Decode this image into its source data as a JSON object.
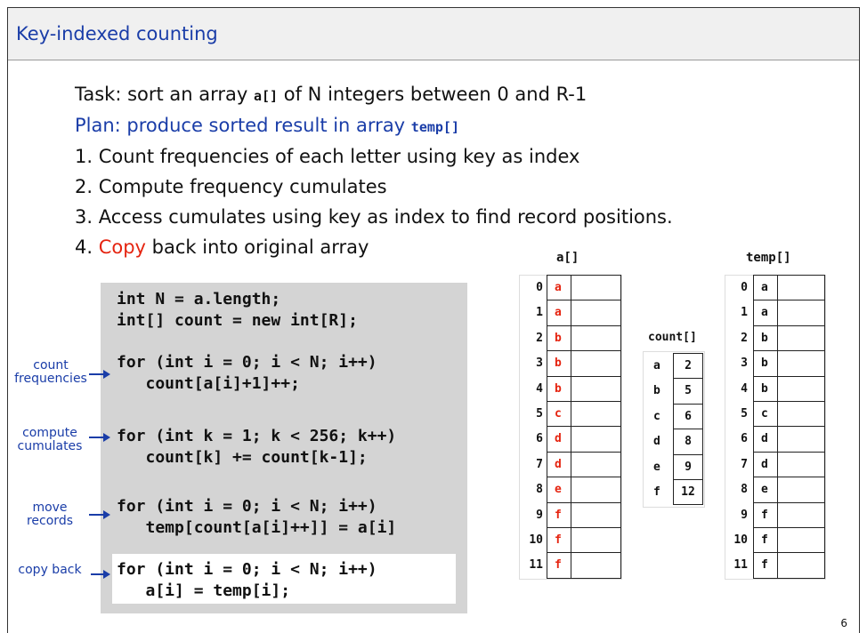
{
  "title": "Key-indexed counting",
  "task": {
    "prefix": "Task: sort an array ",
    "array": "a[]",
    "suffix": " of N integers between 0 and R-1"
  },
  "plan": {
    "prefix": "Plan: produce sorted result in array ",
    "array": "temp[]"
  },
  "steps": [
    "1. Count frequencies of each letter using key as index",
    "2. Compute frequency cumulates",
    "3. Access cumulates using key as index to find record positions."
  ],
  "step4": {
    "num": "4. ",
    "red": "Copy",
    "rest": " back into original array"
  },
  "code": [
    "int N = a.length;",
    "int[] count = new int[R];",
    "for (int i = 0; i < N; i++)",
    "   count[a[i]+1]++;",
    "for (int k = 1; k < 256; k++)",
    "   count[k] += count[k-1];",
    "for (int i = 0; i < N; i++)",
    "   temp[count[a[i]++]] = a[i]",
    "for (int i = 0; i < N; i++)",
    "   a[i] = temp[i];"
  ],
  "side_labels": {
    "count": [
      "count",
      "frequencies"
    ],
    "cumulate": [
      "compute",
      "cumulates"
    ],
    "move": [
      "move",
      "records"
    ],
    "copy": [
      "copy back"
    ]
  },
  "a_label": "a[]",
  "temp_label": "temp[]",
  "count_label": "count[]",
  "indices": [
    "0",
    "1",
    "2",
    "3",
    "4",
    "5",
    "6",
    "7",
    "8",
    "9",
    "10",
    "11"
  ],
  "a_values": [
    "a",
    "a",
    "b",
    "b",
    "b",
    "c",
    "d",
    "d",
    "e",
    "f",
    "f",
    "f"
  ],
  "temp_values": [
    "a",
    "a",
    "b",
    "b",
    "b",
    "c",
    "d",
    "d",
    "e",
    "f",
    "f",
    "f"
  ],
  "count_keys": [
    "a",
    "b",
    "c",
    "d",
    "e",
    "f"
  ],
  "count_values": [
    "2",
    "5",
    "6",
    "8",
    "9",
    "12"
  ],
  "page_number": "6",
  "colors": {
    "blue": "#1a3da8",
    "red": "#e52410",
    "code_bg": "#d4d4d4"
  }
}
